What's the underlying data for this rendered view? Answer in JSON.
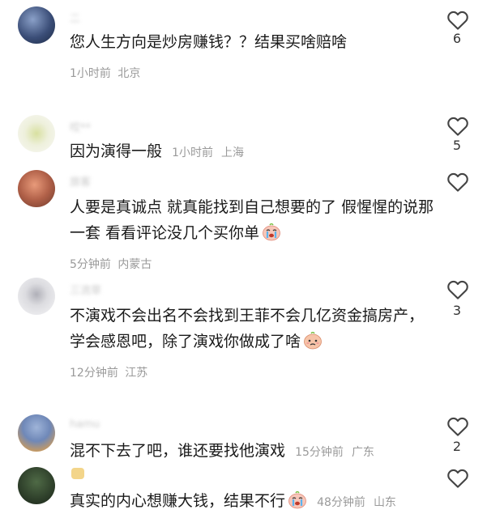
{
  "comments": [
    {
      "username": "二",
      "text": "您人生方向是炒房赚钱？？结果买啥赔啥",
      "time": "1小时前",
      "location": "北京",
      "likes": "6"
    },
    {
      "username": "哎**",
      "text": "因为演得一般",
      "time": "1小时前",
      "location": "上海",
      "likes": "5"
    },
    {
      "username": "旅客",
      "text": "人要是真诚点 就真能找到自己想要的了 假惺惺的说那一套 看看评论没几个买你单",
      "time": "5分钟前",
      "location": "内蒙古",
      "likes": ""
    },
    {
      "username": "三流草",
      "text": "不演戏不会出名不会找到王菲不会几亿资金搞房产，学会感恩吧，除了演戏你做成了啥",
      "time": "12分钟前",
      "location": "江苏",
      "likes": "3"
    },
    {
      "username": "hamu",
      "text": "混不下去了吧，谁还要找他演戏",
      "time": "15分钟前",
      "location": "广东",
      "likes": "2"
    },
    {
      "username": "",
      "text": "真实的内心想赚大钱，结果不行",
      "time": "48分钟前",
      "location": "山东",
      "likes": ""
    }
  ],
  "colors": {
    "text": "#1a1a1a",
    "meta": "#9a9a9a",
    "icon": "#444444"
  },
  "icons": {
    "like": "heart-outline-icon",
    "emoji": "crying-face-emoji",
    "emoji_alt": "sad-face-emoji"
  }
}
